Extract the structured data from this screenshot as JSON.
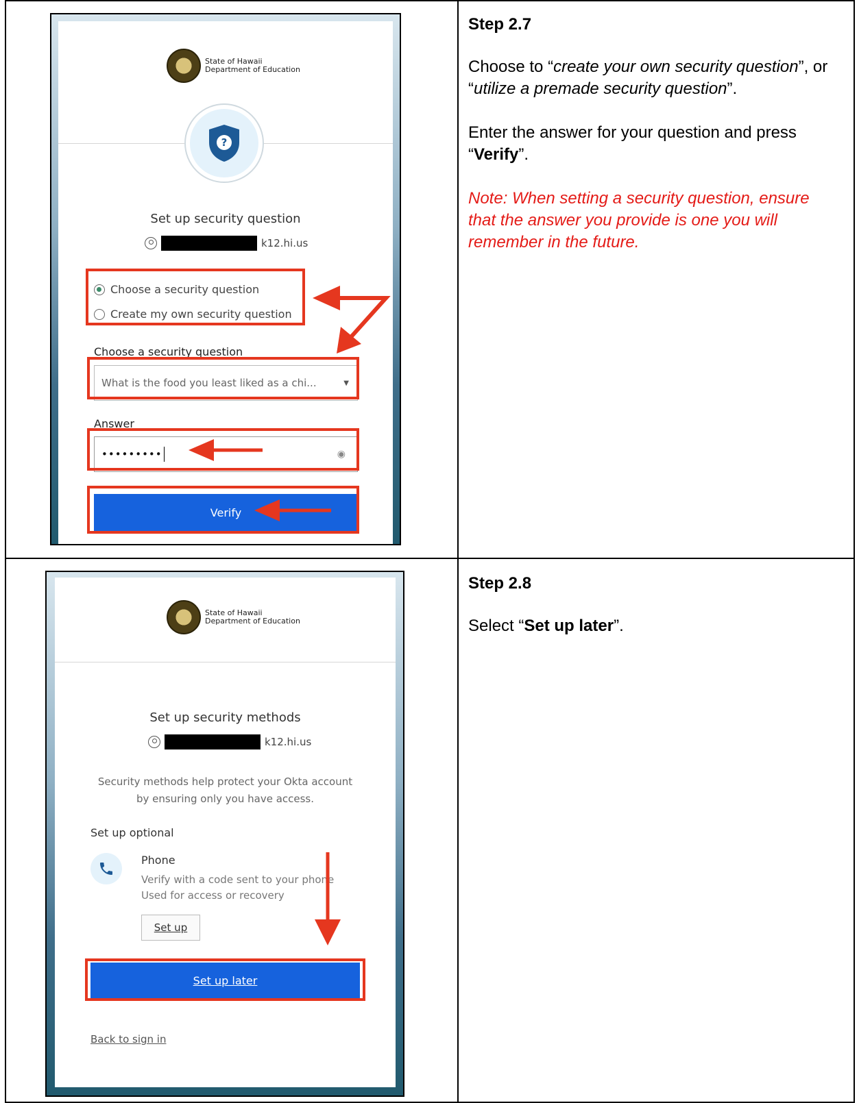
{
  "step27": {
    "heading": "Step 2.7",
    "p1_a": "Choose to “",
    "p1_b": "create your own security question",
    "p1_c": "”, or “",
    "p1_d": "utilize a premade security question",
    "p1_e": "”.",
    "p2_a": "Enter the answer for your question and press “",
    "p2_b": "Verify",
    "p2_c": "”.",
    "note": "Note: When setting a security question, ensure that the answer you provide is one you will remember in the future.",
    "screen": {
      "logo_line1": "State of Hawaii",
      "logo_line2": "Department of Education",
      "title": "Set up security question",
      "user_suffix": "k12.hi.us",
      "radio1": "Choose a security question",
      "radio2": "Create my own security question",
      "select_label": "Choose a security question",
      "select_value": "What is the food you least liked as a chi...",
      "answer_label": "Answer",
      "answer_value": "•••••••••",
      "verify": "Verify"
    }
  },
  "step28": {
    "heading": "Step 2.8",
    "p1_a": "Select “",
    "p1_b": "Set up later",
    "p1_c": "”.",
    "screen": {
      "logo_line1": "State of Hawaii",
      "logo_line2": "Department of Education",
      "title": "Set up security methods",
      "user_suffix": "k12.hi.us",
      "desc": "Security methods help protect your Okta account by ensuring only you have access.",
      "optional": "Set up optional",
      "phone_title": "Phone",
      "phone_desc1": "Verify with a code sent to your phone",
      "phone_desc2": "Used for access or recovery",
      "setup_btn": "Set up",
      "setup_later": "Set up later",
      "back": "Back to sign in"
    }
  },
  "colors": {
    "red_box": "#e5371f",
    "primary": "#1662dd",
    "note": "#e41b17"
  }
}
